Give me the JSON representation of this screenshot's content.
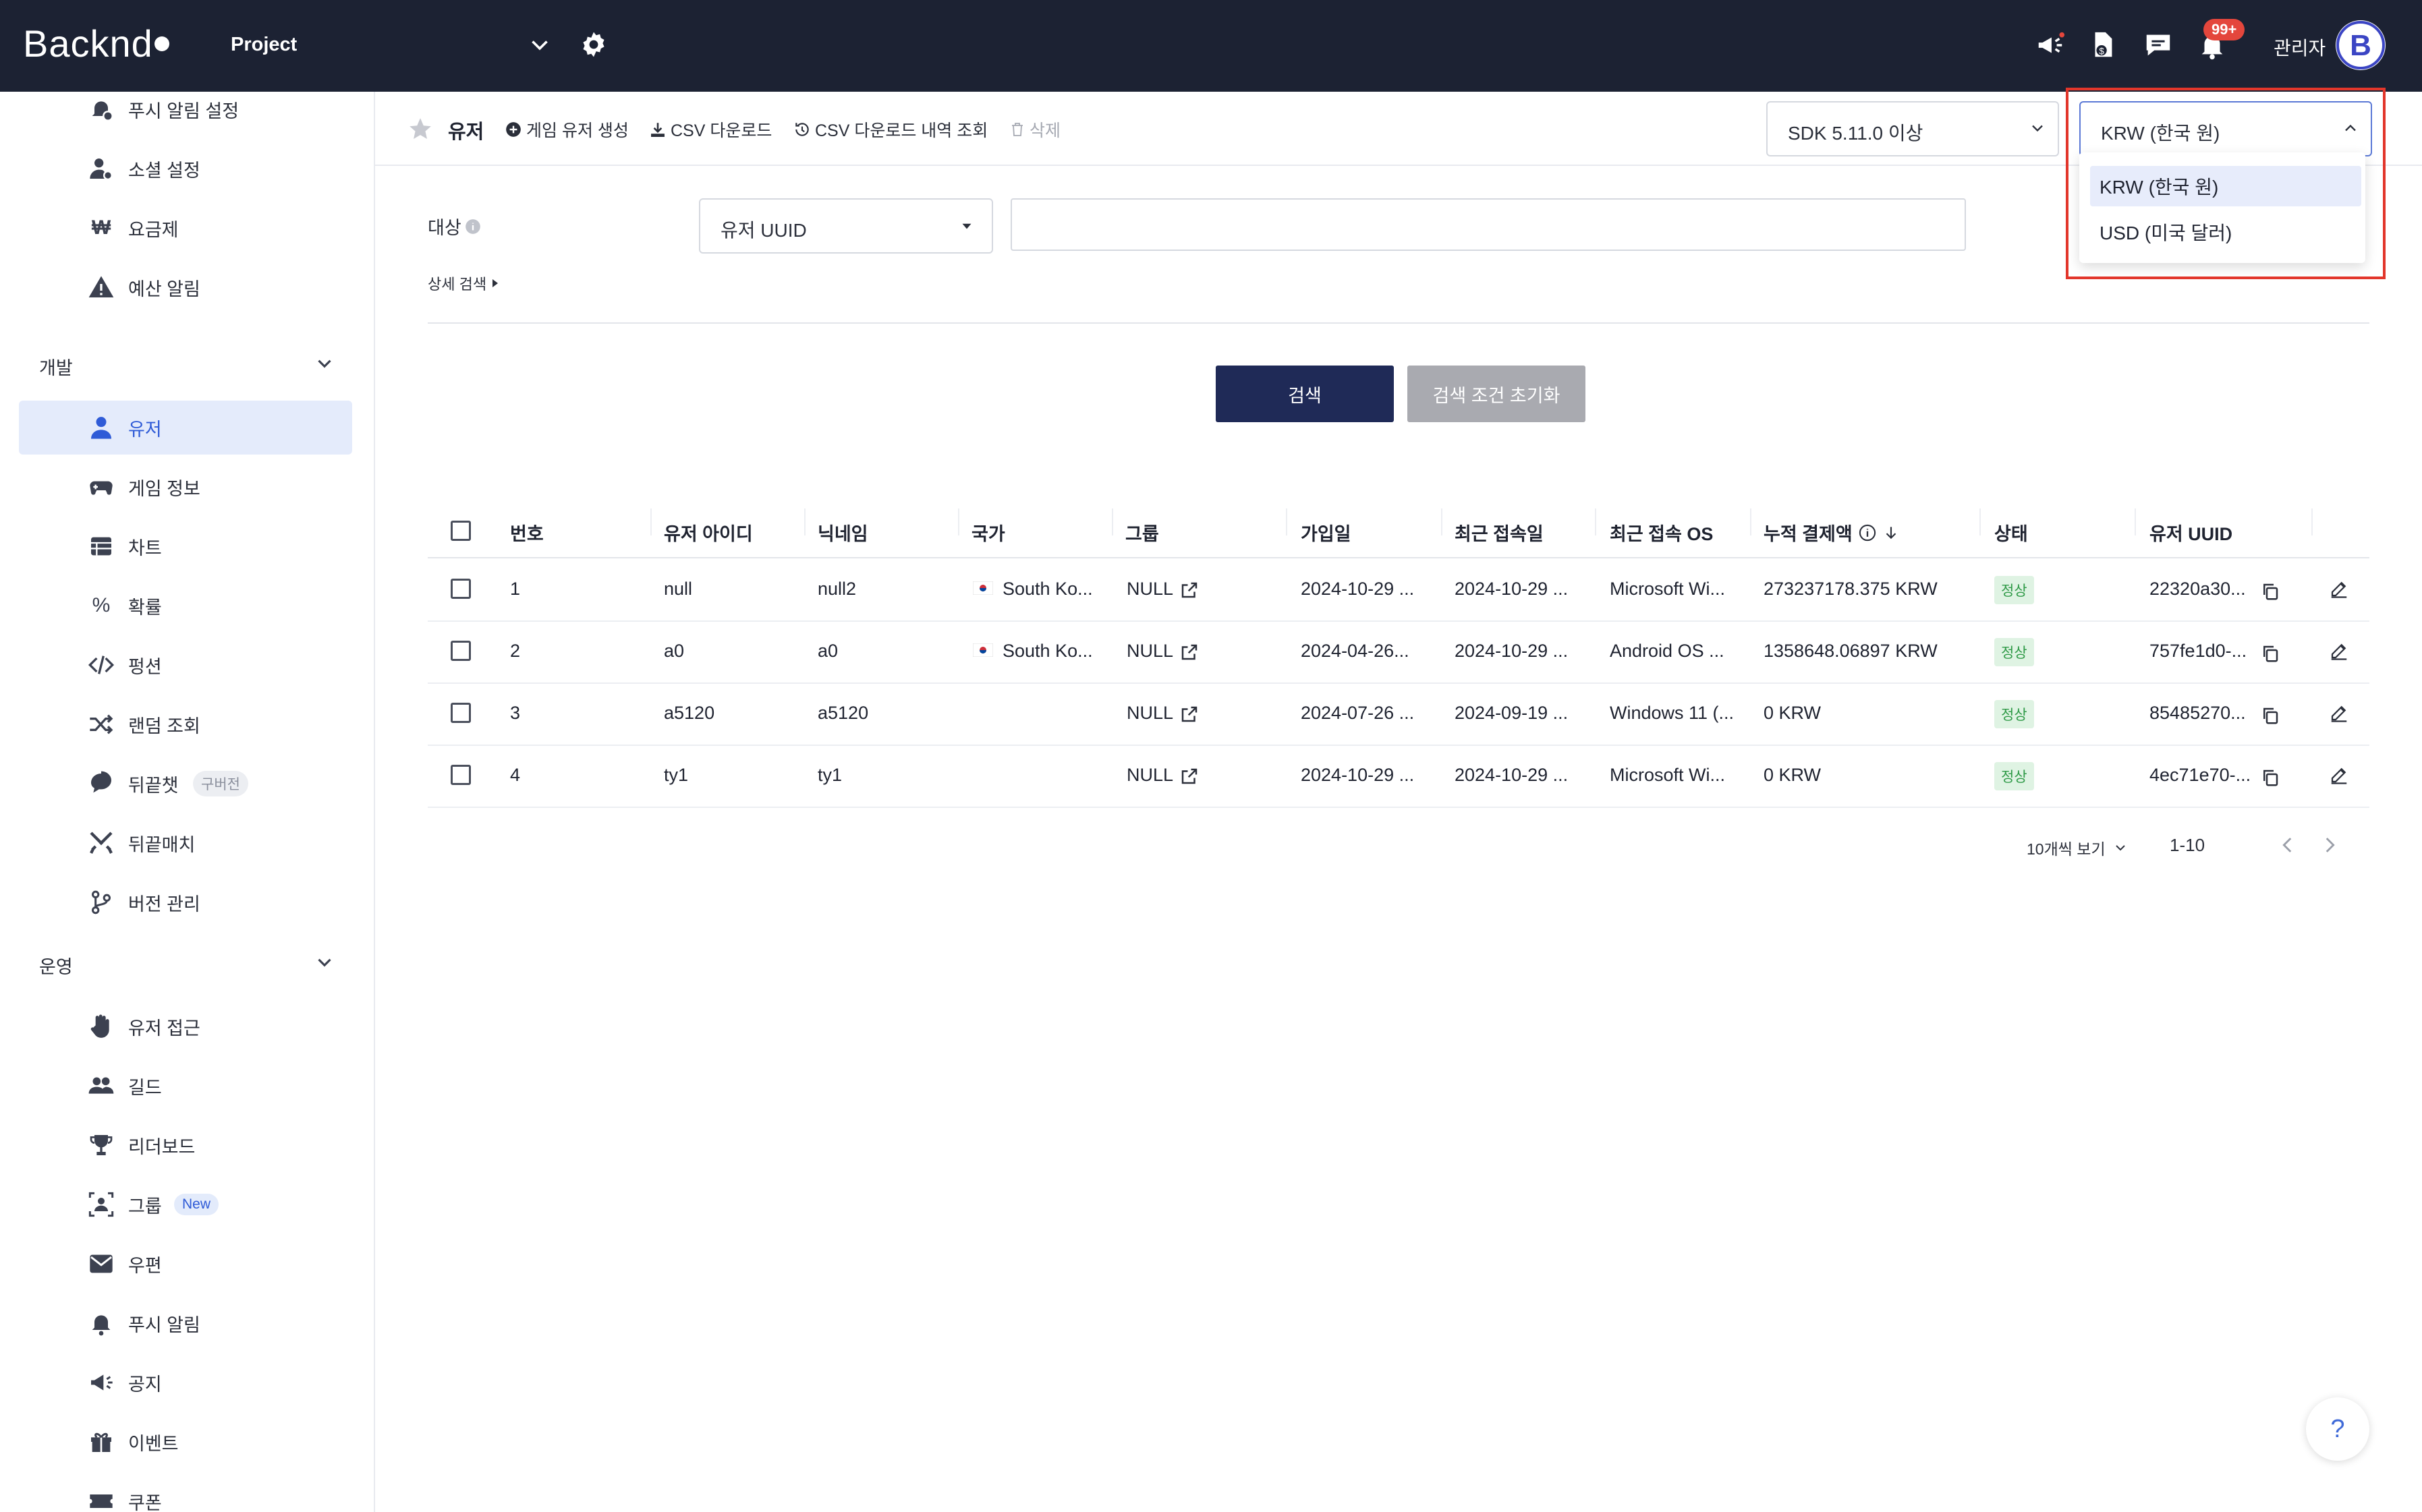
{
  "app": {
    "logo_text": "Backnd",
    "project_name": "Project",
    "notification_count": "99+",
    "user_label": "관리자"
  },
  "sidebar": {
    "items_top": [
      {
        "label": "푸시 알림 설정",
        "icon": "bell-gear-icon"
      },
      {
        "label": "소셜 설정",
        "icon": "user-gear-icon"
      },
      {
        "label": "요금제",
        "icon": "won-icon"
      },
      {
        "label": "예산 알림",
        "icon": "warning-icon"
      }
    ],
    "section_dev": "개발",
    "items_dev": [
      {
        "label": "유저",
        "icon": "user-icon",
        "active": true
      },
      {
        "label": "게임 정보",
        "icon": "gamepad-icon"
      },
      {
        "label": "차트",
        "icon": "table-icon"
      },
      {
        "label": "확률",
        "icon": "percent-icon"
      },
      {
        "label": "펑션",
        "icon": "code-icon"
      },
      {
        "label": "랜덤 조회",
        "icon": "shuffle-icon"
      },
      {
        "label": "뒤끝챗",
        "icon": "chat-icon",
        "tag": "구버전"
      },
      {
        "label": "뒤끝매치",
        "icon": "swords-icon"
      },
      {
        "label": "버전 관리",
        "icon": "branch-icon"
      }
    ],
    "section_ops": "운영",
    "items_ops": [
      {
        "label": "유저 접근",
        "icon": "hand-icon"
      },
      {
        "label": "길드",
        "icon": "group-icon"
      },
      {
        "label": "리더보드",
        "icon": "trophy-icon"
      },
      {
        "label": "그룹",
        "icon": "group-frame-icon",
        "tag": "New"
      },
      {
        "label": "우편",
        "icon": "mail-icon"
      },
      {
        "label": "푸시 알림",
        "icon": "bell-icon"
      },
      {
        "label": "공지",
        "icon": "megaphone-icon"
      },
      {
        "label": "이벤트",
        "icon": "gift-icon"
      },
      {
        "label": "쿠폰",
        "icon": "coupon-icon"
      }
    ]
  },
  "header": {
    "title": "유저",
    "create_label": "게임 유저 생성",
    "csv_label": "CSV 다운로드",
    "csv_history_label": "CSV 다운로드 내역 조회",
    "delete_label": "삭제",
    "sdk_select": "SDK 5.11.0 이상",
    "currency_select": "KRW (한국 원)"
  },
  "currency_dropdown": {
    "options": [
      "KRW (한국 원)",
      "USD (미국 달러)"
    ],
    "selected": "KRW (한국 원)"
  },
  "filter": {
    "target_label": "대상",
    "target_select": "유저 UUID",
    "search_value": "",
    "advanced_label": "상세 검색",
    "search_button": "검색",
    "reset_button": "검색 조건 초기화"
  },
  "table": {
    "columns": [
      "번호",
      "유저 아이디",
      "닉네임",
      "국가",
      "그룹",
      "가입일",
      "최근 접속일",
      "최근 접속 OS",
      "누적 결제액",
      "상태",
      "유저 UUID"
    ],
    "rows": [
      {
        "no": "1",
        "id": "null",
        "nick": "null2",
        "country": "South Ko...",
        "flag": true,
        "group": "NULL",
        "joined": "2024-10-29 ...",
        "last": "2024-10-29 ...",
        "os": "Microsoft Wi...",
        "paid": "273237178.375 KRW",
        "status": "정상",
        "uuid": "22320a30..."
      },
      {
        "no": "2",
        "id": "a0",
        "nick": "a0",
        "country": "South Ko...",
        "flag": true,
        "group": "NULL",
        "joined": "2024-04-26...",
        "last": "2024-10-29 ...",
        "os": "Android OS ...",
        "paid": "1358648.06897 KRW",
        "status": "정상",
        "uuid": "757fe1d0-..."
      },
      {
        "no": "3",
        "id": "a5120",
        "nick": "a5120",
        "country": "",
        "flag": false,
        "group": "NULL",
        "joined": "2024-07-26 ...",
        "last": "2024-09-19 ...",
        "os": "Windows 11 (...",
        "paid": "0 KRW",
        "status": "정상",
        "uuid": "85485270..."
      },
      {
        "no": "4",
        "id": "ty1",
        "nick": "ty1",
        "country": "",
        "flag": false,
        "group": "NULL",
        "joined": "2024-10-29 ...",
        "last": "2024-10-29 ...",
        "os": "Microsoft Wi...",
        "paid": "0 KRW",
        "status": "정상",
        "uuid": "4ec71e70-..."
      }
    ]
  },
  "pagination": {
    "page_size_label": "10개씩 보기",
    "range": "1-10"
  },
  "help_label": "?"
}
